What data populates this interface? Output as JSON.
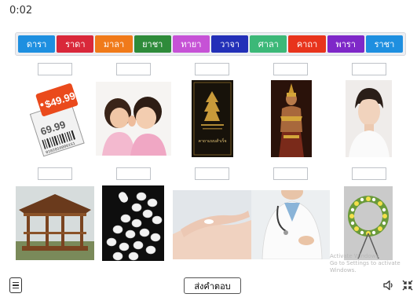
{
  "timer": "0:02",
  "words": [
    {
      "label": "ดารา",
      "color": "#1e8fe0"
    },
    {
      "label": "ราดา",
      "color": "#d9283a"
    },
    {
      "label": "มาลา",
      "color": "#f07a1a"
    },
    {
      "label": "ยาชา",
      "color": "#2e8b3a"
    },
    {
      "label": "ทายา",
      "color": "#c652d6"
    },
    {
      "label": "วาจา",
      "color": "#2330b8"
    },
    {
      "label": "ศาลา",
      "color": "#3cb878"
    },
    {
      "label": "คาถา",
      "color": "#e8341c"
    },
    {
      "label": "พารา",
      "color": "#7e28c8"
    },
    {
      "label": "ราชา",
      "color": "#1e8fe0"
    }
  ],
  "price_tag": {
    "price_big": "$49.99",
    "price_small": "69.99",
    "barcode_number": "0102016000151"
  },
  "book_cover": {
    "title": "คาถาแบบสำเร็จ"
  },
  "submit_label": "ส่งคำตอบ",
  "watermark": {
    "line1": "Activate Windows",
    "line2": "Go to Settings to activate Windows."
  }
}
